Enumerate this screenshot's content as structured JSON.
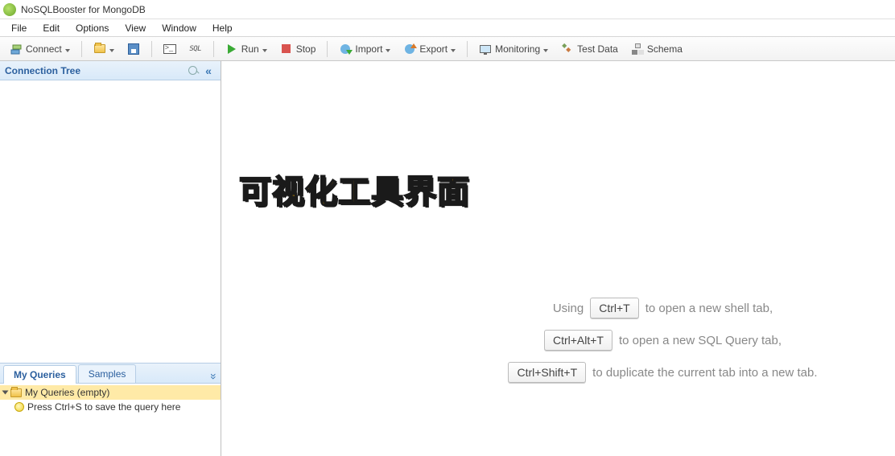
{
  "title": "NoSQLBooster for MongoDB",
  "menu": [
    "File",
    "Edit",
    "Options",
    "View",
    "Window",
    "Help"
  ],
  "toolbar": {
    "connect": "Connect",
    "sql_badge": "SQL",
    "run": "Run",
    "stop": "Stop",
    "import": "Import",
    "export": "Export",
    "monitoring": "Monitoring",
    "test_data": "Test Data",
    "schema": "Schema"
  },
  "sidebar": {
    "header": "Connection Tree",
    "tabs": {
      "my_queries": "My Queries",
      "samples": "Samples"
    },
    "queries": {
      "root": "My Queries (empty)",
      "hint": "Press Ctrl+S to save the query here"
    }
  },
  "overlay": "可视化工具界面",
  "hints": {
    "row1": {
      "pre": "Using",
      "kbd": "Ctrl+T",
      "post": "to open a new shell tab,"
    },
    "row2": {
      "kbd": "Ctrl+Alt+T",
      "post": "to open a new SQL Query tab,"
    },
    "row3": {
      "kbd": "Ctrl+Shift+T",
      "post": "to duplicate the current tab into a new tab."
    }
  }
}
